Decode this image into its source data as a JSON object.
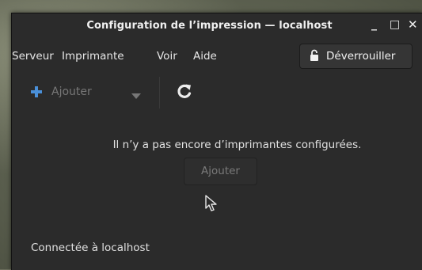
{
  "window": {
    "title": "Configuration de l’impression — localhost",
    "controls": {
      "minimize": "_",
      "maximize": "□",
      "close": "✕"
    }
  },
  "menubar": {
    "items": [
      {
        "label": "Serveur"
      },
      {
        "label": "Imprimante"
      },
      {
        "label": "Voir"
      },
      {
        "label": "Aide"
      }
    ]
  },
  "unlock_button": {
    "label": "Déverrouiller",
    "icon": "lock-icon"
  },
  "toolbar": {
    "add_label": "Ajouter",
    "add_icon": "plus-icon",
    "dropdown_icon": "dropdown-arrow-icon",
    "refresh_icon": "refresh-icon"
  },
  "main": {
    "empty_message": "Il n’y a pas encore d’imprimantes configurées.",
    "add_button_label": "Ajouter"
  },
  "status": {
    "text": "Connectée à localhost"
  },
  "colors": {
    "window_bg": "#2b2b2b",
    "accent": "#4a90d9",
    "text": "#e6e6e6",
    "disabled_text": "#777777"
  }
}
